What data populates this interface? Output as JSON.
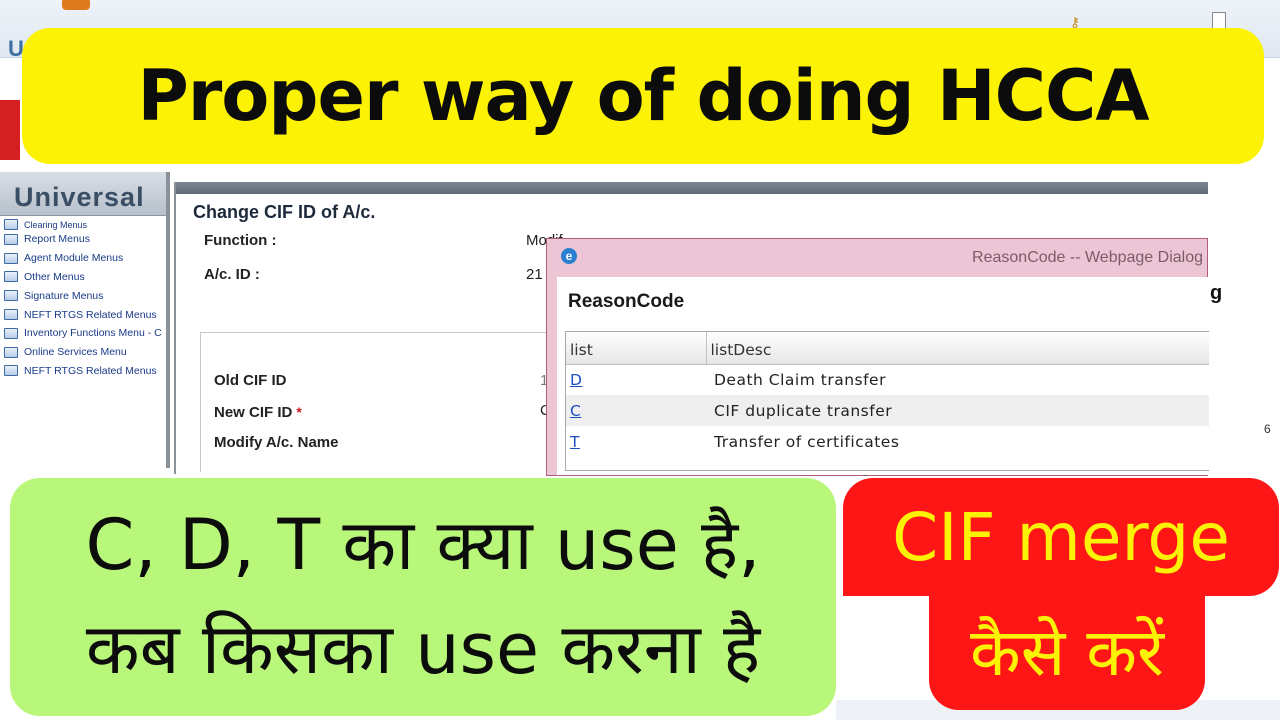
{
  "banners": {
    "top": "Proper way of doing HCCA",
    "green_line1": "C, D, T का क्या use है,",
    "green_line2": "कब किसका use करना है",
    "red_line1": "CIF merge",
    "red_line2": "कैसे करें"
  },
  "app": {
    "top_letter": "U",
    "brand": "Universal",
    "right_letter": "g",
    "right_number": "6"
  },
  "sidebar": {
    "items": [
      {
        "label": "Clearing Menus"
      },
      {
        "label": "Report Menus"
      },
      {
        "label": "Agent Module Menus"
      },
      {
        "label": "Other Menus"
      },
      {
        "label": "Signature Menus"
      },
      {
        "label": "NEFT RTGS Related Menus"
      },
      {
        "label": "Inventory Functions Menu - C"
      },
      {
        "label": "Online Services Menu"
      },
      {
        "label": "NEFT RTGS Related Menus"
      }
    ]
  },
  "form": {
    "title": "Change CIF ID of A/c.",
    "function_label": "Function :",
    "function_value": "Modif",
    "acid_label": "A/c. ID :",
    "acid_value": "21",
    "old_cif_label": "Old CIF ID",
    "old_cif_value": "1",
    "new_cif_label": "New CIF ID",
    "new_cif_required": "*",
    "new_cif_value": "C",
    "modify_name_label": "Modify A/c. Name"
  },
  "dialog": {
    "title": "ReasonCode -- Webpage Dialog",
    "heading": "ReasonCode",
    "columns": [
      "list",
      "listDesc"
    ],
    "rows": [
      {
        "code": "D",
        "desc": "Death Claim transfer"
      },
      {
        "code": "C",
        "desc": "CIF duplicate transfer"
      },
      {
        "code": "T",
        "desc": "Transfer of certificates"
      }
    ]
  },
  "colors": {
    "banner_top": "#fcf206",
    "banner_green": "#b9f77b",
    "banner_red": "#fe1616",
    "banner_red_text": "#fcf206",
    "dialog_frame": "#ecc6d4",
    "link_blue": "#1b4fc0"
  },
  "icons": {
    "menu_item_icon": "folder-arrow-icon",
    "dialog_icon": "ie-browser-icon"
  }
}
